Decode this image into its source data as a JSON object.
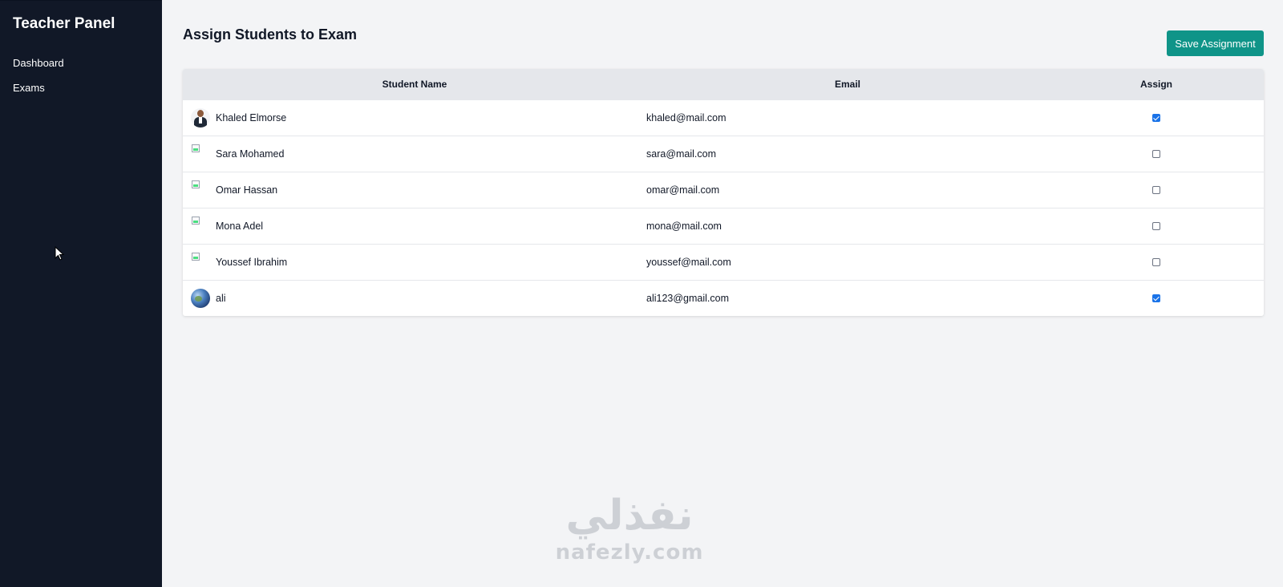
{
  "sidebar": {
    "brand": "Teacher Panel",
    "items": [
      {
        "label": "Dashboard"
      },
      {
        "label": "Exams"
      }
    ]
  },
  "header": {
    "title": "Assign Students to Exam",
    "save_label": "Save Assignment"
  },
  "table": {
    "columns": [
      "Student Name",
      "Email",
      "Assign"
    ],
    "rows": [
      {
        "name": "Khaled Elmorse",
        "email": "khaled@mail.com",
        "avatar": "photo-icon",
        "assigned": true
      },
      {
        "name": "Sara Mohamed",
        "email": "sara@mail.com",
        "avatar": "broken-image-icon",
        "assigned": false
      },
      {
        "name": "Omar Hassan",
        "email": "omar@mail.com",
        "avatar": "broken-image-icon",
        "assigned": false
      },
      {
        "name": "Mona Adel",
        "email": "mona@mail.com",
        "avatar": "broken-image-icon",
        "assigned": false
      },
      {
        "name": "Youssef Ibrahim",
        "email": "youssef@mail.com",
        "avatar": "broken-image-icon",
        "assigned": false
      },
      {
        "name": "ali",
        "email": "ali123@gmail.com",
        "avatar": "globe-icon",
        "assigned": true
      }
    ]
  },
  "watermark": {
    "arabic": "نفذلي",
    "latin": "nafezly.com"
  },
  "colors": {
    "sidebar_bg": "#111827",
    "accent": "#0f9488",
    "checkbox_checked": "#1a73e8"
  }
}
